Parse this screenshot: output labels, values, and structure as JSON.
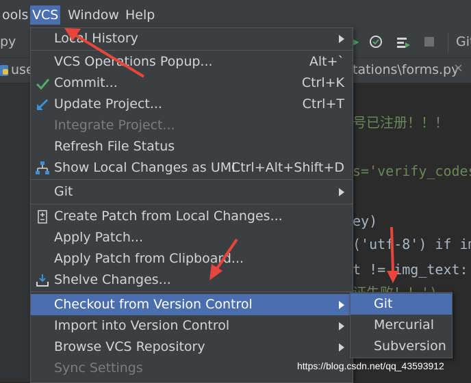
{
  "menubar": {
    "items": [
      {
        "label": "ools"
      },
      {
        "label": "VCS"
      },
      {
        "label": "Window"
      },
      {
        "label": "Help"
      }
    ]
  },
  "toolbar": {
    "left_text": "py",
    "right_text": "Git"
  },
  "tabbar": {
    "left_tab": "use",
    "file_tab": "tations\\forms.py"
  },
  "editor": {
    "lines": [
      "号已注册！！！",
      "s='verify_codes",
      "ey)",
      "('utf-8') if im",
      "t != img_text:",
      "证失败！！')"
    ]
  },
  "vcs_menu": {
    "items": [
      {
        "label": "Local History",
        "shortcut": "",
        "submenu": true
      },
      {
        "label": "VCS Operations Popup...",
        "shortcut": "Alt+`"
      },
      {
        "label": "Commit...",
        "shortcut": "Ctrl+K",
        "icon": "checkmark-icon"
      },
      {
        "label": "Update Project...",
        "shortcut": "Ctrl+T",
        "icon": "update-arrow-icon"
      },
      {
        "label": "Integrate Project...",
        "shortcut": "",
        "disabled": true
      },
      {
        "label": "Refresh File Status",
        "shortcut": ""
      },
      {
        "label": "Show Local Changes as UML",
        "shortcut": "Ctrl+Alt+Shift+D",
        "icon": "uml-diagram-icon"
      },
      {
        "label": "Git",
        "shortcut": "",
        "submenu": true
      },
      {
        "label": "Create Patch from Local Changes...",
        "shortcut": "",
        "icon": "patch-file-icon"
      },
      {
        "label": "Apply Patch...",
        "shortcut": ""
      },
      {
        "label": "Apply Patch from Clipboard...",
        "shortcut": ""
      },
      {
        "label": "Shelve Changes...",
        "shortcut": "",
        "icon": "shelve-icon"
      },
      {
        "label": "Checkout from Version Control",
        "shortcut": "",
        "submenu": true,
        "selected": true
      },
      {
        "label": "Import into Version Control",
        "shortcut": "",
        "submenu": true
      },
      {
        "label": "Browse VCS Repository",
        "shortcut": "",
        "submenu": true
      },
      {
        "label": "Sync Settings",
        "shortcut": "",
        "disabled": true
      }
    ]
  },
  "submenu": {
    "items": [
      {
        "label": "Git"
      },
      {
        "label": "Mercurial"
      },
      {
        "label": "Subversion"
      }
    ]
  },
  "watermark": "https://blog.csdn.net/qq_43593912",
  "colors": {
    "accent": "#4b6eaf",
    "annotation_red": "#e8453c",
    "menu_bg": "#3c3f41"
  }
}
